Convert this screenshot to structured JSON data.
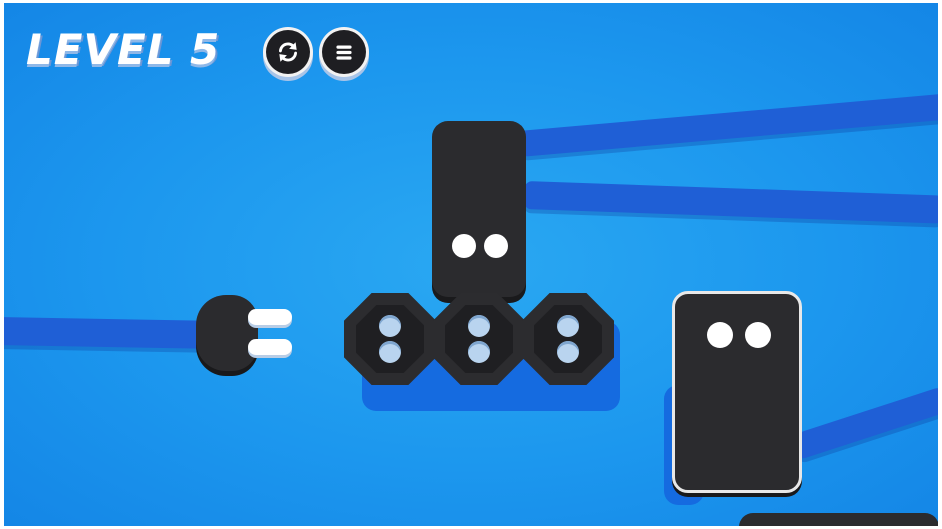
{
  "hud": {
    "level_label": "LEVEL 5",
    "restart_icon": "restart-icon",
    "menu_icon": "menu-icon"
  },
  "colors": {
    "background": "#1c97ee",
    "cable": "#1f5fd6",
    "block": "#2b2b2e",
    "hud_text": "#ffffff"
  },
  "board": {
    "plug": {
      "prongs": 2
    },
    "outlet_strip": {
      "sockets": 3,
      "holes_per_socket": 2
    },
    "plug_blocks": [
      {
        "name": "top-plug-block",
        "pins": 2
      },
      {
        "name": "right-plug-block",
        "pins": 2,
        "selected": true
      }
    ]
  }
}
